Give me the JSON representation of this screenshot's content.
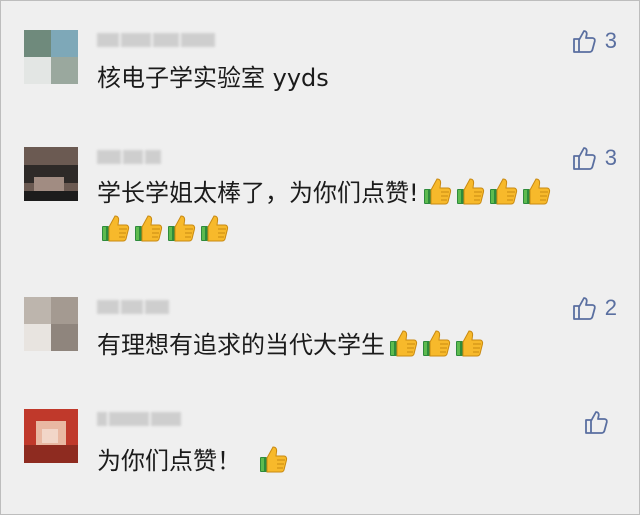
{
  "comments": [
    {
      "text_parts": [
        "核电子学实验室 yyds"
      ],
      "likes": "3",
      "emoji_count": 0,
      "avatar": "blurred-avatar-1",
      "colors": [
        "#6f8a7c",
        "#c8d0cf",
        "#7ea8b8",
        "#e3e6e4",
        "#9aa89e"
      ]
    },
    {
      "text_parts": [
        "学长学姐太棒了，为你们点赞!"
      ],
      "likes": "3",
      "emoji_count": 8,
      "avatar": "blurred-avatar-2",
      "colors": [
        "#2e2a28",
        "#6b5a52",
        "#a18c82",
        "#d9cfc9",
        "#1c1c1c"
      ]
    },
    {
      "text_parts": [
        "有理想有追求的当代大学生"
      ],
      "likes": "2",
      "emoji_count": 3,
      "avatar": "blurred-avatar-3",
      "colors": [
        "#d9d4cf",
        "#bdb5ad",
        "#8f857d",
        "#e8e4e0",
        "#a49a91"
      ]
    },
    {
      "text_parts": [
        "为你们点赞！"
      ],
      "likes": "",
      "emoji_count": 1,
      "avatar": "blurred-avatar-4",
      "colors": [
        "#c0392b",
        "#e9b8a2",
        "#8e2b20",
        "#f2d6c8",
        "#b04a35"
      ]
    }
  ],
  "icons": {
    "like": "thumbs-up-outline-icon",
    "emoji": "thumbs-up-emoji-icon"
  },
  "accent": "#5a6fa0"
}
